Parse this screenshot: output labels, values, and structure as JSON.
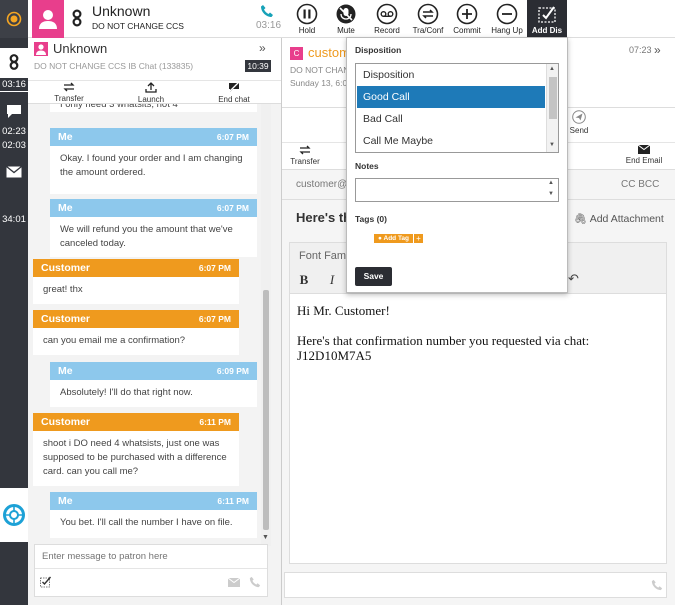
{
  "rail": {
    "times": [
      "03:16",
      "02:23",
      "02:03",
      "34:01"
    ]
  },
  "header": {
    "caller": "Unknown",
    "queue": "DO NOT CHANGE CCS",
    "call_time": "03:16",
    "buttons": [
      {
        "label": "Hold"
      },
      {
        "label": "Mute"
      },
      {
        "label": "Record"
      },
      {
        "label": "Tra/Conf"
      },
      {
        "label": "Commit"
      },
      {
        "label": "Hang Up"
      },
      {
        "label": "Add Dis"
      }
    ]
  },
  "chat": {
    "title": "Unknown",
    "subtitle": "DO NOT CHANGE CCS IB Chat (133835)",
    "timer": "10:39",
    "toolbar": {
      "transfer": "Transfer",
      "launch": "Launch",
      "end": "End chat"
    },
    "partial_text": "I only need 3 whatsits, not 4",
    "messages": [
      {
        "sender": "Me",
        "time": "6:07 PM",
        "text": "Okay. I found your order and I am changing the amount ordered."
      },
      {
        "sender": "Me",
        "time": "6:07 PM",
        "text": "We will refund you the amount that we've canceled today."
      },
      {
        "sender": "Customer",
        "time": "6:07 PM",
        "text": "great! thx"
      },
      {
        "sender": "Customer",
        "time": "6:07 PM",
        "text": "can you email me a confirmation?"
      },
      {
        "sender": "Me",
        "time": "6:09 PM",
        "text": "Absolutely! I'll do that right now."
      },
      {
        "sender": "Customer",
        "time": "6:11 PM",
        "text": "shoot i DO need 4 whatsists, just one was supposed to be purchased with a difference card. can you call me?"
      },
      {
        "sender": "Me",
        "time": "6:11 PM",
        "text": "You bet. I'll call the number I have on file."
      }
    ],
    "input_placeholder": "Enter message to patron here"
  },
  "email": {
    "title": "custom",
    "queue": "DO NOT CHAN",
    "date": "Sunday 13, 6:0",
    "timer": "07:23",
    "send": "Send",
    "transfer": "Transfer",
    "end": "End Email",
    "to": "customer@",
    "cc": "CC BCC",
    "subject": "Here's th",
    "attach": "Add Attachment",
    "font": "Font Fam",
    "bold": "B",
    "italic": "I",
    "body": [
      "Hi Mr. Customer!",
      "Here's that confirmation number you requested via chat:",
      "J12D10M7A5"
    ]
  },
  "dropdown": {
    "disposition_label": "Disposition",
    "options": [
      "Disposition",
      "Good Call",
      "Bad Call",
      "Call Me Maybe"
    ],
    "selected_index": 1,
    "notes_label": "Notes",
    "tags_label": "Tags (0)",
    "add_tag": "Add Tag",
    "save": "Save"
  },
  "colors": {
    "pink": "#e83e8c",
    "orange": "#ef9a1e",
    "blue": "#8dc8ec",
    "selected": "#1e7ab8",
    "rail": "#33363d"
  }
}
